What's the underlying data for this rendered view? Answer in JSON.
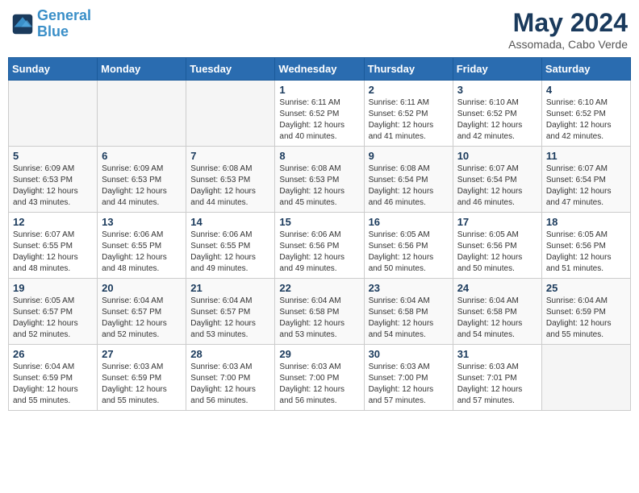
{
  "header": {
    "logo_line1": "General",
    "logo_line2": "Blue",
    "month": "May 2024",
    "location": "Assomada, Cabo Verde"
  },
  "weekdays": [
    "Sunday",
    "Monday",
    "Tuesday",
    "Wednesday",
    "Thursday",
    "Friday",
    "Saturday"
  ],
  "weeks": [
    [
      {
        "day": "",
        "info": ""
      },
      {
        "day": "",
        "info": ""
      },
      {
        "day": "",
        "info": ""
      },
      {
        "day": "1",
        "info": "Sunrise: 6:11 AM\nSunset: 6:52 PM\nDaylight: 12 hours\nand 40 minutes."
      },
      {
        "day": "2",
        "info": "Sunrise: 6:11 AM\nSunset: 6:52 PM\nDaylight: 12 hours\nand 41 minutes."
      },
      {
        "day": "3",
        "info": "Sunrise: 6:10 AM\nSunset: 6:52 PM\nDaylight: 12 hours\nand 42 minutes."
      },
      {
        "day": "4",
        "info": "Sunrise: 6:10 AM\nSunset: 6:52 PM\nDaylight: 12 hours\nand 42 minutes."
      }
    ],
    [
      {
        "day": "5",
        "info": "Sunrise: 6:09 AM\nSunset: 6:53 PM\nDaylight: 12 hours\nand 43 minutes."
      },
      {
        "day": "6",
        "info": "Sunrise: 6:09 AM\nSunset: 6:53 PM\nDaylight: 12 hours\nand 44 minutes."
      },
      {
        "day": "7",
        "info": "Sunrise: 6:08 AM\nSunset: 6:53 PM\nDaylight: 12 hours\nand 44 minutes."
      },
      {
        "day": "8",
        "info": "Sunrise: 6:08 AM\nSunset: 6:53 PM\nDaylight: 12 hours\nand 45 minutes."
      },
      {
        "day": "9",
        "info": "Sunrise: 6:08 AM\nSunset: 6:54 PM\nDaylight: 12 hours\nand 46 minutes."
      },
      {
        "day": "10",
        "info": "Sunrise: 6:07 AM\nSunset: 6:54 PM\nDaylight: 12 hours\nand 46 minutes."
      },
      {
        "day": "11",
        "info": "Sunrise: 6:07 AM\nSunset: 6:54 PM\nDaylight: 12 hours\nand 47 minutes."
      }
    ],
    [
      {
        "day": "12",
        "info": "Sunrise: 6:07 AM\nSunset: 6:55 PM\nDaylight: 12 hours\nand 48 minutes."
      },
      {
        "day": "13",
        "info": "Sunrise: 6:06 AM\nSunset: 6:55 PM\nDaylight: 12 hours\nand 48 minutes."
      },
      {
        "day": "14",
        "info": "Sunrise: 6:06 AM\nSunset: 6:55 PM\nDaylight: 12 hours\nand 49 minutes."
      },
      {
        "day": "15",
        "info": "Sunrise: 6:06 AM\nSunset: 6:56 PM\nDaylight: 12 hours\nand 49 minutes."
      },
      {
        "day": "16",
        "info": "Sunrise: 6:05 AM\nSunset: 6:56 PM\nDaylight: 12 hours\nand 50 minutes."
      },
      {
        "day": "17",
        "info": "Sunrise: 6:05 AM\nSunset: 6:56 PM\nDaylight: 12 hours\nand 50 minutes."
      },
      {
        "day": "18",
        "info": "Sunrise: 6:05 AM\nSunset: 6:56 PM\nDaylight: 12 hours\nand 51 minutes."
      }
    ],
    [
      {
        "day": "19",
        "info": "Sunrise: 6:05 AM\nSunset: 6:57 PM\nDaylight: 12 hours\nand 52 minutes."
      },
      {
        "day": "20",
        "info": "Sunrise: 6:04 AM\nSunset: 6:57 PM\nDaylight: 12 hours\nand 52 minutes."
      },
      {
        "day": "21",
        "info": "Sunrise: 6:04 AM\nSunset: 6:57 PM\nDaylight: 12 hours\nand 53 minutes."
      },
      {
        "day": "22",
        "info": "Sunrise: 6:04 AM\nSunset: 6:58 PM\nDaylight: 12 hours\nand 53 minutes."
      },
      {
        "day": "23",
        "info": "Sunrise: 6:04 AM\nSunset: 6:58 PM\nDaylight: 12 hours\nand 54 minutes."
      },
      {
        "day": "24",
        "info": "Sunrise: 6:04 AM\nSunset: 6:58 PM\nDaylight: 12 hours\nand 54 minutes."
      },
      {
        "day": "25",
        "info": "Sunrise: 6:04 AM\nSunset: 6:59 PM\nDaylight: 12 hours\nand 55 minutes."
      }
    ],
    [
      {
        "day": "26",
        "info": "Sunrise: 6:04 AM\nSunset: 6:59 PM\nDaylight: 12 hours\nand 55 minutes."
      },
      {
        "day": "27",
        "info": "Sunrise: 6:03 AM\nSunset: 6:59 PM\nDaylight: 12 hours\nand 55 minutes."
      },
      {
        "day": "28",
        "info": "Sunrise: 6:03 AM\nSunset: 7:00 PM\nDaylight: 12 hours\nand 56 minutes."
      },
      {
        "day": "29",
        "info": "Sunrise: 6:03 AM\nSunset: 7:00 PM\nDaylight: 12 hours\nand 56 minutes."
      },
      {
        "day": "30",
        "info": "Sunrise: 6:03 AM\nSunset: 7:00 PM\nDaylight: 12 hours\nand 57 minutes."
      },
      {
        "day": "31",
        "info": "Sunrise: 6:03 AM\nSunset: 7:01 PM\nDaylight: 12 hours\nand 57 minutes."
      },
      {
        "day": "",
        "info": ""
      }
    ]
  ]
}
